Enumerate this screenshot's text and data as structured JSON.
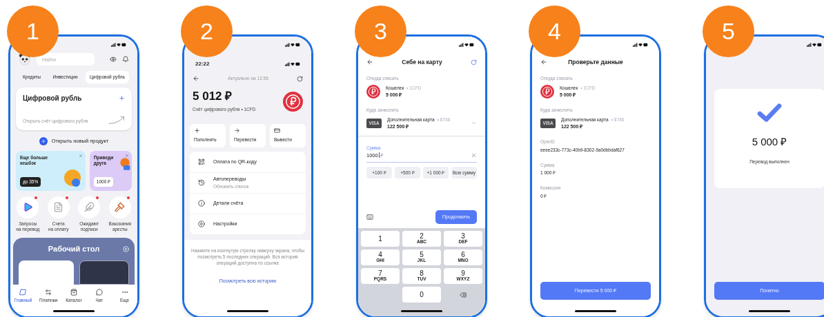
{
  "screens": [
    {
      "kind": "home",
      "number": "1",
      "search": {
        "placeholder": "Найти"
      },
      "tabs": [
        {
          "label": "Кредиты",
          "selected": false
        },
        {
          "label": "Инвестиции",
          "selected": false
        },
        {
          "label": "Цифровой рубль",
          "selected": true
        }
      ],
      "card": {
        "title": "Цифровой рубль",
        "subtitle": "Открыть счёт цифрового рубля"
      },
      "new_product": "Открыть новый продукт",
      "promos": [
        {
          "kind": "cashback",
          "title": "Еще больше\nкешбэк",
          "badge": "до 35%",
          "color": "#cdeefa"
        },
        {
          "kind": "referral",
          "title": "Приведи\nдруга",
          "badge": "1000 ₽",
          "color": "#dccbf7"
        }
      ],
      "shortcuts": [
        {
          "kind": "requests",
          "label": "Запросы\nна перевод",
          "unread": true
        },
        {
          "kind": "invoices",
          "label": "Счета\nна оплату",
          "unread": true
        },
        {
          "kind": "signatures",
          "label": "Ожидают\nподписи",
          "unread": true
        },
        {
          "kind": "arrests",
          "label": "Взыскания\nаресты",
          "unread": true
        }
      ],
      "workspace": {
        "title": "Рабочий стол"
      },
      "nav": [
        {
          "kind": "home",
          "label": "Главный",
          "selected": true
        },
        {
          "kind": "payments",
          "label": "Платежи",
          "selected": false
        },
        {
          "kind": "catalog",
          "label": "Каталог",
          "selected": false
        },
        {
          "kind": "chat",
          "label": "Чат",
          "selected": false
        },
        {
          "kind": "more",
          "label": "Еще",
          "selected": false
        }
      ]
    },
    {
      "kind": "account",
      "number": "2",
      "time": "22:22",
      "updated": "Актуально на 12:56",
      "balance": "5 012 ₽",
      "account": "Счёт цифрового рубля • 1CFD",
      "actions": [
        {
          "kind": "topup",
          "label": "Пополнить"
        },
        {
          "kind": "transfer",
          "label": "Перевести"
        },
        {
          "kind": "withdraw",
          "label": "Вывести"
        }
      ],
      "menu": [
        {
          "kind": "qr",
          "label": "Оплата по QR-коду"
        },
        {
          "kind": "auto",
          "label": "Автопереводы",
          "sub": "Обновить список"
        },
        {
          "kind": "details",
          "label": "Детали счёта"
        },
        {
          "kind": "settings",
          "label": "Настройки"
        }
      ],
      "hint": "Нажмите на изогнутую стрелку наверху экрана, чтобы посмотреть 5 последних операций. Вся история операций доступна по ссылке",
      "link": "Посмотреть всю историю"
    },
    {
      "kind": "transfer",
      "number": "3",
      "title": "Себе на карту",
      "from": {
        "label": "Откуда списать",
        "name": "Кошелек",
        "code": "• 1CFD",
        "amount": "5 000 ₽"
      },
      "to": {
        "label": "Куда зачислить",
        "name": "Дополнительная карта",
        "code": "• 8746",
        "amount": "122 500 ₽",
        "card_text": "VISA"
      },
      "amount": {
        "label": "Сумма",
        "value": "1000",
        "currency": "₽"
      },
      "chips": [
        "+100 ₽",
        "+500 ₽",
        "+1 000 ₽",
        "Всю сумму"
      ],
      "button": "Продолжить",
      "keys": [
        {
          "kind": "digit",
          "digit": "1"
        },
        {
          "kind": "digit",
          "digit": "2",
          "letters": "ABC"
        },
        {
          "kind": "digit",
          "digit": "3",
          "letters": "DEF"
        },
        {
          "kind": "digit",
          "digit": "4",
          "letters": "GHI"
        },
        {
          "kind": "digit",
          "digit": "5",
          "letters": "JKL"
        },
        {
          "kind": "digit",
          "digit": "6",
          "letters": "MNO"
        },
        {
          "kind": "digit",
          "digit": "7",
          "letters": "PQRS"
        },
        {
          "kind": "digit",
          "digit": "8",
          "letters": "TUV"
        },
        {
          "kind": "digit",
          "digit": "9",
          "letters": "WXYZ"
        },
        {
          "kind": "digit",
          "digit": "0"
        },
        {
          "kind": "backspace"
        }
      ]
    },
    {
      "kind": "confirm",
      "number": "4",
      "title": "Проверьте данные",
      "from": {
        "label": "Откуда списать",
        "name": "Кошелек",
        "code": "• 1CFD",
        "amount": "5 000 ₽"
      },
      "to": {
        "label": "Куда зачислить",
        "name": "Дополнительная карта",
        "code": "• 8746",
        "amount": "122 500 ₽",
        "card_text": "VISA"
      },
      "fields": [
        {
          "label": "OperID",
          "value": "eeee233c-773c-40b9-8302-9a0dbbdaf627"
        },
        {
          "label": "Сумма",
          "value": "1 000 ₽"
        },
        {
          "label": "Комиссия",
          "value": "0 ₽"
        }
      ],
      "button": "Перевести 5 000 ₽"
    },
    {
      "kind": "success",
      "number": "5",
      "amount": "5 000 ₽",
      "message": "Перевод выполнен",
      "button": "Понятно"
    }
  ]
}
